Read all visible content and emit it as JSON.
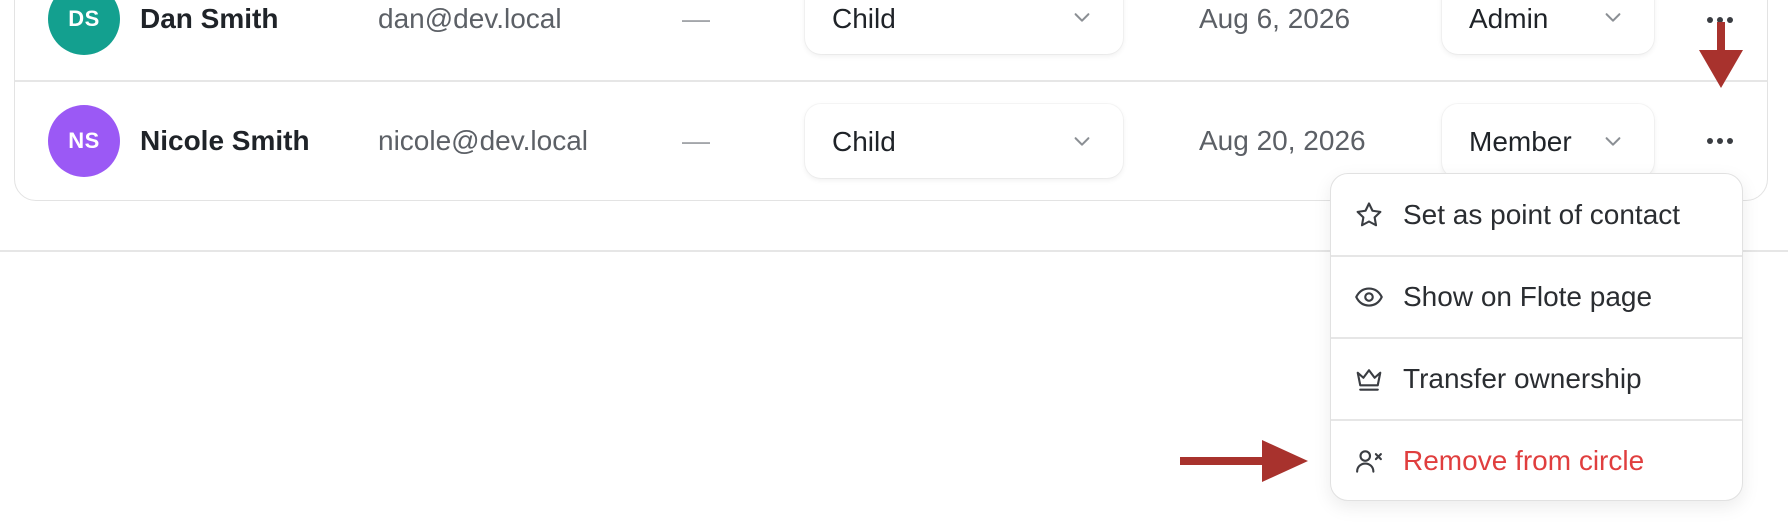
{
  "members": [
    {
      "initials": "DS",
      "avatar_color": "#13a08f",
      "name": "Dan Smith",
      "email": "dan@dev.local",
      "extra": "—",
      "relation": "Child",
      "date": "Aug 6, 2026",
      "role": "Admin"
    },
    {
      "initials": "NS",
      "avatar_color": "#9b59f5",
      "name": "Nicole Smith",
      "email": "nicole@dev.local",
      "extra": "—",
      "relation": "Child",
      "date": "Aug 20, 2026",
      "role": "Member"
    }
  ],
  "context_menu": {
    "items": [
      {
        "label": "Set as point of contact",
        "icon": "star-icon"
      },
      {
        "label": "Show on Flote page",
        "icon": "eye-icon"
      },
      {
        "label": "Transfer ownership",
        "icon": "crown-icon"
      },
      {
        "label": "Remove from circle",
        "icon": "user-remove-icon",
        "danger": true
      }
    ]
  },
  "colors": {
    "danger": "#e03e3e",
    "annotation_arrow": "#a8322d"
  }
}
